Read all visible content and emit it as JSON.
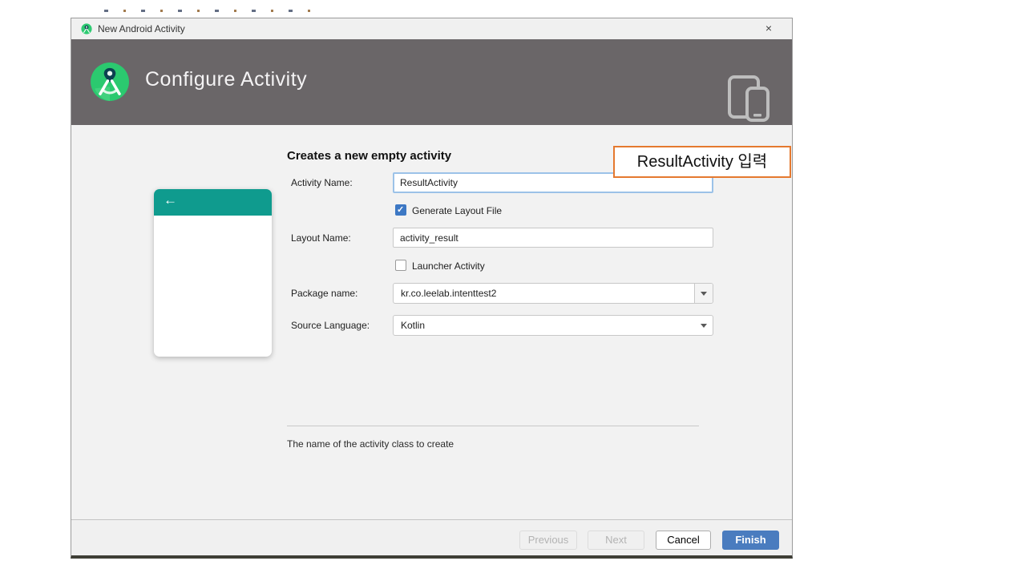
{
  "titlebar": {
    "title": "New Android Activity",
    "close_glyph": "×"
  },
  "header": {
    "title": "Configure Activity"
  },
  "form": {
    "heading": "Creates a new empty activity",
    "activity_name_label": "Activity Name:",
    "activity_name_value": "ResultActivity",
    "generate_layout_label": "Generate Layout File",
    "generate_layout_checked": true,
    "layout_name_label": "Layout Name:",
    "layout_name_value": "activity_result",
    "launcher_label": "Launcher Activity",
    "launcher_checked": false,
    "package_label": "Package name:",
    "package_value": "kr.co.leelab.intenttest2",
    "language_label": "Source Language:",
    "language_value": "Kotlin",
    "hint": "The name of the activity class to create"
  },
  "preview": {
    "back_glyph": "←"
  },
  "annotation": {
    "text": "ResultActivity 입력"
  },
  "footer": {
    "previous": "Previous",
    "next": "Next",
    "cancel": "Cancel",
    "finish": "Finish"
  },
  "colors": {
    "header_bg": "#6a6668",
    "accent_teal": "#0f9b8e",
    "finish_blue": "#4a7cbf",
    "checkbox_blue": "#3d78c4",
    "annotation_orange": "#e5792f",
    "focus_border": "#9cc2e8"
  }
}
